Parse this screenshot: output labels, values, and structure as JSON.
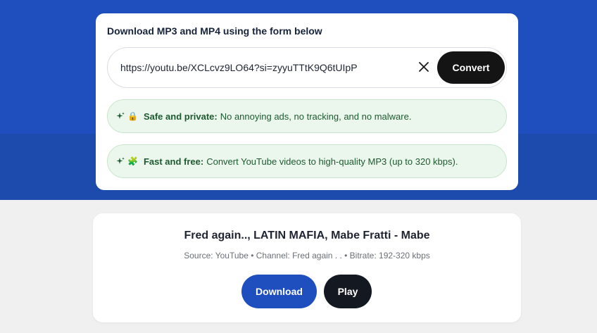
{
  "form": {
    "title": "Download MP3 and MP4 using the form below",
    "url_value": "https://youtu.be/XCLcvz9LO64?si=zyyuTTtK9Q6tUIpP",
    "convert_label": "Convert",
    "features": [
      {
        "emoji": "🔒",
        "title": "Safe and private:",
        "text": "No annoying ads, no tracking, and no malware."
      },
      {
        "emoji": "🧩",
        "title": "Fast and free:",
        "text": "Convert YouTube videos to high-quality MP3 (up to 320 kbps)."
      }
    ]
  },
  "result": {
    "title": "Fred again.., LATIN MAFIA, Mabe Fratti - Mabe",
    "meta": "Source: YouTube • Channel: Fred again . . • Bitrate: 192-320 kbps",
    "download_label": "Download",
    "play_label": "Play"
  },
  "icons": {
    "clear": "close-icon",
    "sparkle": "sparkle-icon"
  },
  "colors": {
    "header_bg": "#1f4fbf",
    "accent_blue": "#1f4fbf",
    "dark_button": "#141414",
    "feature_bg": "#ebf6ec",
    "feature_text": "#1d5a30"
  }
}
